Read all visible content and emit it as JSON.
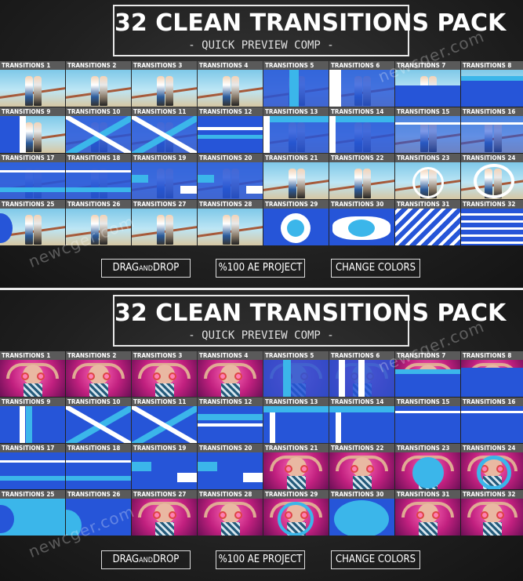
{
  "panels": [
    {
      "title": "32 CLEAN TRANSITIONS PACK",
      "subtitle": "- QUICK PREVIEW  COMP -",
      "theme": "sky",
      "transitions": [
        "TRANSITIONS 1",
        "TRANSITIONS 2",
        "TRANSITIONS 3",
        "TRANSITIONS 4",
        "TRANSITIONS 5",
        "TRANSITIONS 6",
        "TRANSITIONS 7",
        "TRANSITIONS 8",
        "TRANSITIONS 9",
        "TRANSITIONS 10",
        "TRANSITIONS 11",
        "TRANSITIONS 12",
        "TRANSITIONS 13",
        "TRANSITIONS 14",
        "TRANSITIONS 15",
        "TRANSITIONS 16",
        "TRANSITIONS 17",
        "TRANSITIONS 18",
        "TRANSITIONS 19",
        "TRANSITIONS 20",
        "TRANSITIONS 21",
        "TRANSITIONS 22",
        "TRANSITIONS 23",
        "TRANSITIONS 24",
        "TRANSITIONS 25",
        "TRANSITIONS 26",
        "TRANSITIONS 27",
        "TRANSITIONS 28",
        "TRANSITIONS 29",
        "TRANSITIONS 30",
        "TRANSITIONS 31",
        "TRANSITIONS 32"
      ],
      "buttons": {
        "drag_main1": "DRAG",
        "drag_small": "AND",
        "drag_main2": "DROP",
        "project": "%100 AE PROJECT",
        "colors": "CHANGE COLORS"
      }
    },
    {
      "title": "32 CLEAN TRANSITIONS PACK",
      "subtitle": "- QUICK PREVIEW  COMP -",
      "theme": "pink",
      "transitions": [
        "TRANSITIONS 1",
        "TRANSITIONS 2",
        "TRANSITIONS 3",
        "TRANSITIONS 4",
        "TRANSITIONS 5",
        "TRANSITIONS 6",
        "TRANSITIONS 7",
        "TRANSITIONS 8",
        "TRANSITIONS 9",
        "TRANSITIONS 10",
        "TRANSITIONS 11",
        "TRANSITIONS 12",
        "TRANSITIONS 13",
        "TRANSITIONS 14",
        "TRANSITIONS 15",
        "TRANSITIONS 16",
        "TRANSITIONS 17",
        "TRANSITIONS 18",
        "TRANSITIONS 19",
        "TRANSITIONS 20",
        "TRANSITIONS 21",
        "TRANSITIONS 22",
        "TRANSITIONS 23",
        "TRANSITIONS 24",
        "TRANSITIONS 25",
        "TRANSITIONS 26",
        "TRANSITIONS 27",
        "TRANSITIONS 28",
        "TRANSITIONS 29",
        "TRANSITIONS 30",
        "TRANSITIONS 31",
        "TRANSITIONS 32"
      ],
      "buttons": {
        "drag_main1": "DRAG",
        "drag_small": "AND",
        "drag_main2": "DROP",
        "project": "%100 AE PROJECT",
        "colors": "CHANGE COLORS"
      }
    }
  ],
  "watermark": "newcger.com",
  "colors": {
    "accent_blue": "#2655d8",
    "accent_cyan": "#3bb6ea",
    "label_bg": "#5a5a5a"
  }
}
